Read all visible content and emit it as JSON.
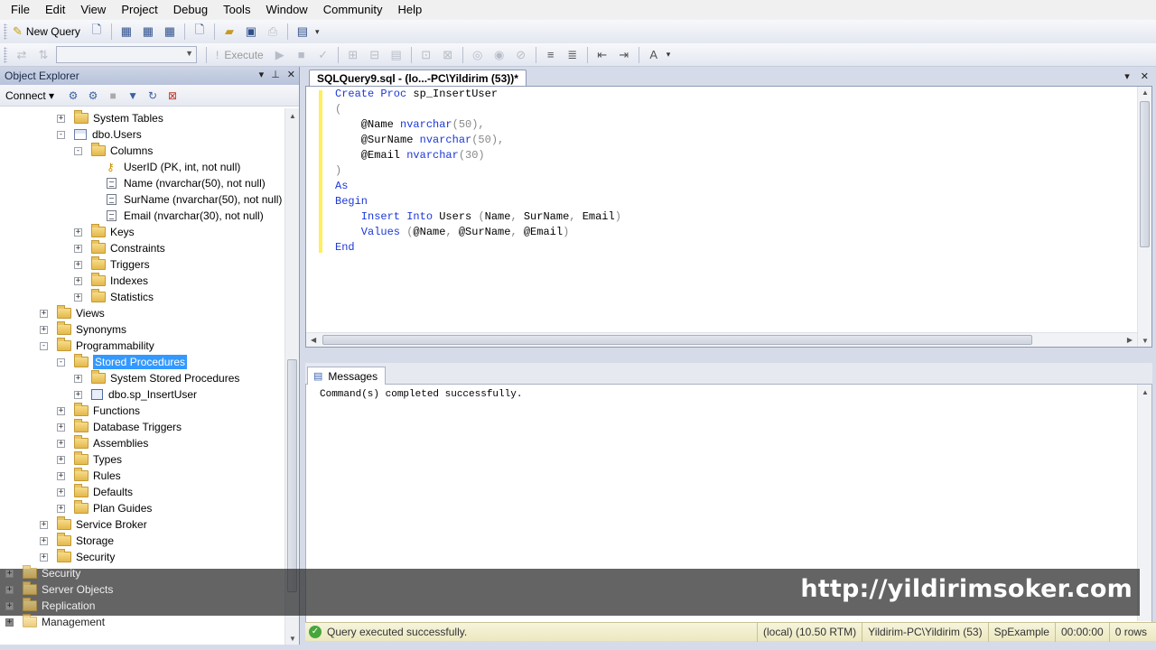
{
  "menu": [
    "File",
    "Edit",
    "View",
    "Project",
    "Debug",
    "Tools",
    "Window",
    "Community",
    "Help"
  ],
  "toolbar": {
    "new_query_label": "New Query",
    "execute_label": "Execute"
  },
  "object_explorer": {
    "title": "Object Explorer",
    "connect_label": "Connect",
    "tree": [
      {
        "label": "System Tables",
        "level": 3,
        "icon": "folder",
        "expander": "+"
      },
      {
        "label": "dbo.Users",
        "level": 3,
        "icon": "table",
        "expander": "-"
      },
      {
        "label": "Columns",
        "level": 4,
        "icon": "folder",
        "expander": "-"
      },
      {
        "label": "UserID (PK, int, not null)",
        "level": 5,
        "icon": "key",
        "expander": ""
      },
      {
        "label": "Name (nvarchar(50), not null)",
        "level": 5,
        "icon": "column",
        "expander": ""
      },
      {
        "label": "SurName (nvarchar(50), not null)",
        "level": 5,
        "icon": "column",
        "expander": ""
      },
      {
        "label": "Email (nvarchar(30), not null)",
        "level": 5,
        "icon": "column",
        "expander": ""
      },
      {
        "label": "Keys",
        "level": 4,
        "icon": "folder",
        "expander": "+"
      },
      {
        "label": "Constraints",
        "level": 4,
        "icon": "folder",
        "expander": "+"
      },
      {
        "label": "Triggers",
        "level": 4,
        "icon": "folder",
        "expander": "+"
      },
      {
        "label": "Indexes",
        "level": 4,
        "icon": "folder",
        "expander": "+"
      },
      {
        "label": "Statistics",
        "level": 4,
        "icon": "folder",
        "expander": "+"
      },
      {
        "label": "Views",
        "level": 2,
        "icon": "folder",
        "expander": "+"
      },
      {
        "label": "Synonyms",
        "level": 2,
        "icon": "folder",
        "expander": "+"
      },
      {
        "label": "Programmability",
        "level": 2,
        "icon": "folder",
        "expander": "-"
      },
      {
        "label": "Stored Procedures",
        "level": 3,
        "icon": "folder",
        "expander": "-",
        "selected": true
      },
      {
        "label": "System Stored Procedures",
        "level": 4,
        "icon": "folder",
        "expander": "+"
      },
      {
        "label": "dbo.sp_InsertUser",
        "level": 4,
        "icon": "proc",
        "expander": "+"
      },
      {
        "label": "Functions",
        "level": 3,
        "icon": "folder",
        "expander": "+"
      },
      {
        "label": "Database Triggers",
        "level": 3,
        "icon": "folder",
        "expander": "+"
      },
      {
        "label": "Assemblies",
        "level": 3,
        "icon": "folder",
        "expander": "+"
      },
      {
        "label": "Types",
        "level": 3,
        "icon": "folder",
        "expander": "+"
      },
      {
        "label": "Rules",
        "level": 3,
        "icon": "folder",
        "expander": "+"
      },
      {
        "label": "Defaults",
        "level": 3,
        "icon": "folder",
        "expander": "+"
      },
      {
        "label": "Plan Guides",
        "level": 3,
        "icon": "folder",
        "expander": "+"
      },
      {
        "label": "Service Broker",
        "level": 2,
        "icon": "folder",
        "expander": "+"
      },
      {
        "label": "Storage",
        "level": 2,
        "icon": "folder",
        "expander": "+"
      },
      {
        "label": "Security",
        "level": 2,
        "icon": "folder",
        "expander": "+"
      }
    ],
    "overlay_tree": [
      "Security",
      "Server Objects",
      "Replication",
      "Management"
    ]
  },
  "editor": {
    "tab_title": "SQLQuery9.sql - (lo...-PC\\Yildirim (53))*",
    "code": [
      [
        {
          "t": "Create Proc ",
          "c": "kw"
        },
        {
          "t": "sp_InsertUser",
          "c": "tx"
        }
      ],
      [
        {
          "t": "(",
          "c": "gr"
        }
      ],
      [
        {
          "t": "    @Name ",
          "c": "tx"
        },
        {
          "t": "nvarchar",
          "c": "kw"
        },
        {
          "t": "(50),",
          "c": "gr"
        }
      ],
      [
        {
          "t": "    @SurName ",
          "c": "tx"
        },
        {
          "t": "nvarchar",
          "c": "kw"
        },
        {
          "t": "(50),",
          "c": "gr"
        }
      ],
      [
        {
          "t": "    @Email ",
          "c": "tx"
        },
        {
          "t": "nvarchar",
          "c": "kw"
        },
        {
          "t": "(30)",
          "c": "gr"
        }
      ],
      [
        {
          "t": ")",
          "c": "gr"
        }
      ],
      [
        {
          "t": "As",
          "c": "kw"
        }
      ],
      [
        {
          "t": "Begin",
          "c": "kw"
        }
      ],
      [
        {
          "t": "    Insert Into ",
          "c": "kw"
        },
        {
          "t": "Users ",
          "c": "tx"
        },
        {
          "t": "(",
          "c": "gr"
        },
        {
          "t": "Name",
          "c": "tx"
        },
        {
          "t": ", ",
          "c": "gr"
        },
        {
          "t": "SurName",
          "c": "tx"
        },
        {
          "t": ", ",
          "c": "gr"
        },
        {
          "t": "Email",
          "c": "tx"
        },
        {
          "t": ")",
          "c": "gr"
        }
      ],
      [
        {
          "t": "    Values ",
          "c": "kw"
        },
        {
          "t": "(",
          "c": "gr"
        },
        {
          "t": "@Name",
          "c": "tx"
        },
        {
          "t": ", ",
          "c": "gr"
        },
        {
          "t": "@SurName",
          "c": "tx"
        },
        {
          "t": ", ",
          "c": "gr"
        },
        {
          "t": "@Email",
          "c": "tx"
        },
        {
          "t": ")",
          "c": "gr"
        }
      ],
      [
        {
          "t": "End",
          "c": "kw"
        }
      ]
    ]
  },
  "results": {
    "tab_label": "Messages",
    "message": "Command(s) completed successfully."
  },
  "status": {
    "message": "Query executed successfully.",
    "server": "(local) (10.50 RTM)",
    "user": "Yildirim-PC\\Yildirim (53)",
    "database": "SpExample",
    "time": "00:00:00",
    "rows": "0 rows"
  },
  "watermark": "http://yildirimsoker.com",
  "colors": {
    "keyword": "#1b38d8",
    "selection": "#3399ff",
    "status_bg": "#f6f4dc",
    "success": "#46a63a"
  }
}
